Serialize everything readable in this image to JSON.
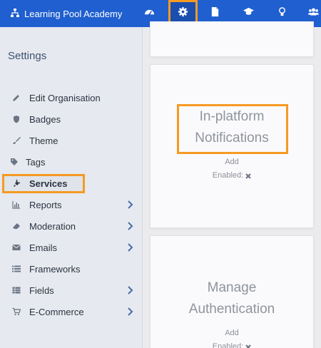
{
  "header": {
    "brand": "Learning Pool Academy",
    "nav": [
      "dashboard-icon",
      "gear-icon",
      "document-icon",
      "graduation-cap-icon",
      "lightbulb-icon",
      "users-icon"
    ],
    "colors": {
      "bar": "#1f5fcf",
      "highlight": "#f59a23"
    }
  },
  "sidebar": {
    "title": "Settings",
    "items": [
      {
        "label": "Edit Organisation",
        "icon": "pencil-icon",
        "chevron": false
      },
      {
        "label": "Badges",
        "icon": "shield-icon",
        "chevron": false
      },
      {
        "label": "Theme",
        "icon": "brush-icon",
        "chevron": false
      },
      {
        "label": "Tags",
        "icon": "tag-icon",
        "chevron": false
      },
      {
        "label": "Services",
        "icon": "plug-icon",
        "chevron": false,
        "active": true
      },
      {
        "label": "Reports",
        "icon": "bar-chart-icon",
        "chevron": true
      },
      {
        "label": "Moderation",
        "icon": "eraser-icon",
        "chevron": true
      },
      {
        "label": "Emails",
        "icon": "envelope-icon",
        "chevron": true
      },
      {
        "label": "Frameworks",
        "icon": "list-icon",
        "chevron": false
      },
      {
        "label": "Fields",
        "icon": "table-icon",
        "chevron": true
      },
      {
        "label": "E-Commerce",
        "icon": "cart-icon",
        "chevron": true
      }
    ]
  },
  "cards": [
    {
      "title_line1": "In-platform",
      "title_line2": "Notifications",
      "add": "Add",
      "enabled": "Enabled:"
    },
    {
      "title_line1": "Manage",
      "title_line2": "Authentication",
      "add": "Add",
      "enabled": "Enabled:"
    }
  ]
}
